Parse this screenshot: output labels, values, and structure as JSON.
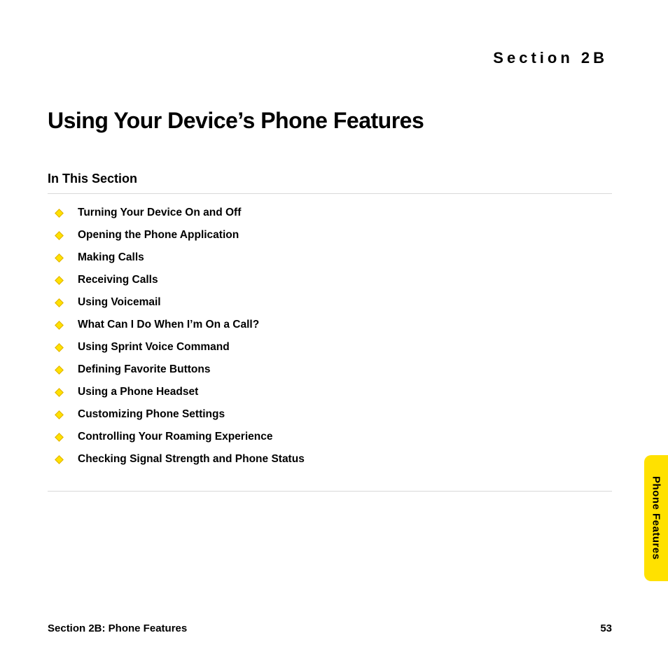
{
  "header": {
    "section_label": "Section 2B"
  },
  "title": "Using Your Device’s Phone Features",
  "subheading": "In This Section",
  "toc": [
    "Turning Your Device On and Off",
    "Opening the Phone Application",
    "Making Calls",
    "Receiving Calls",
    "Using Voicemail",
    "What Can I Do When I’m On a Call?",
    "Using Sprint Voice Command",
    "Defining Favorite Buttons",
    "Using a Phone Headset",
    "Customizing Phone Settings",
    "Controlling Your Roaming Experience",
    "Checking Signal Strength and Phone Status"
  ],
  "footer": {
    "left": "Section 2B: Phone Features",
    "page": "53"
  },
  "side_tab": "Phone Features"
}
